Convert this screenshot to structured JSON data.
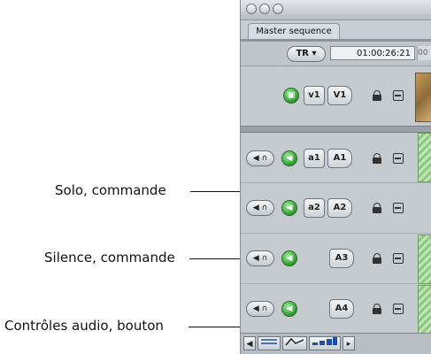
{
  "window": {
    "tab_label": "Master sequence",
    "timecode_mode": "TR",
    "timecode": "01:00:26:21",
    "timecode_overflow": "00"
  },
  "video_tracks": [
    {
      "source_label": "v1",
      "dest_label": "V1"
    }
  ],
  "audio_tracks": [
    {
      "source_label": "a1",
      "dest_label": "A1"
    },
    {
      "source_label": "a2",
      "dest_label": "A2"
    },
    {
      "source_label": "",
      "dest_label": "A3"
    },
    {
      "source_label": "",
      "dest_label": "A4"
    }
  ],
  "callouts": {
    "solo": "Solo, commande",
    "mute": "Silence, commande",
    "audio_controls": "Contrôles audio, bouton"
  },
  "icons": {
    "speaker": "◀",
    "headphones": "∩",
    "green_speaker": "◀",
    "tr_arrow": "▾"
  },
  "colors": {
    "panel_bg": "#c9ced3",
    "green_light": "#2a9a2a"
  }
}
